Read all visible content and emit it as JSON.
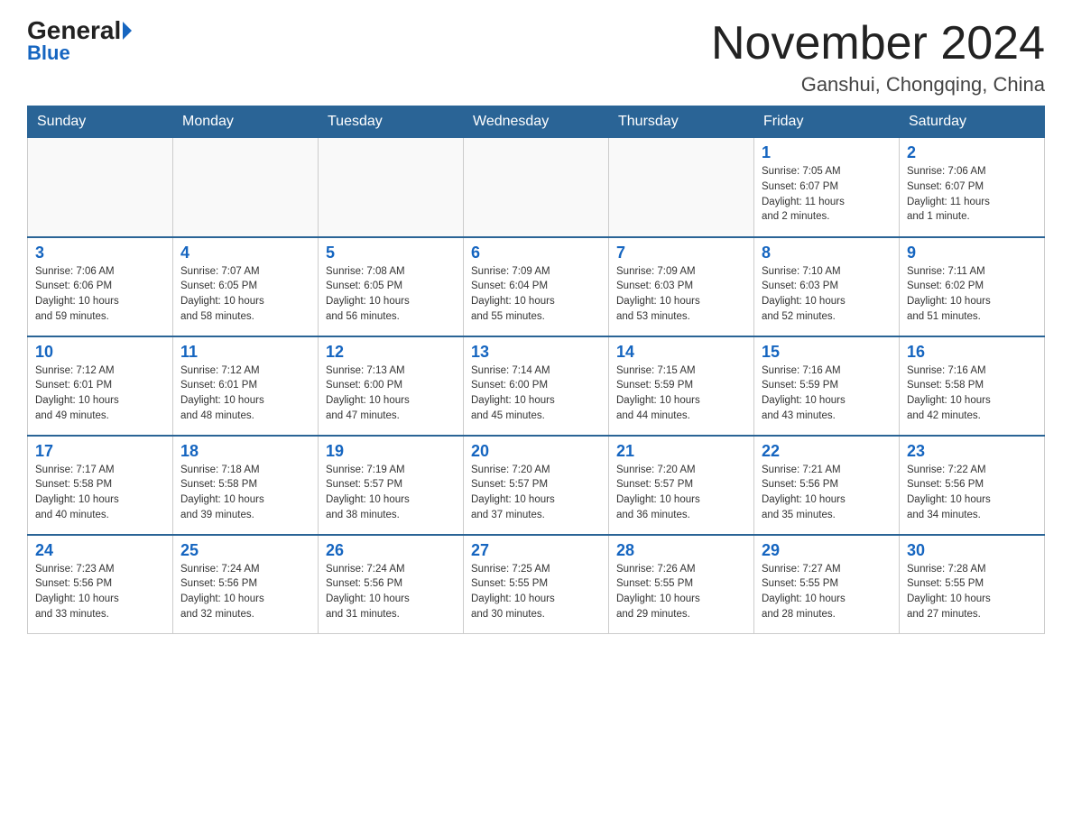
{
  "header": {
    "logo_general": "General",
    "logo_blue": "Blue",
    "title": "November 2024",
    "location": "Ganshui, Chongqing, China"
  },
  "weekdays": [
    "Sunday",
    "Monday",
    "Tuesday",
    "Wednesday",
    "Thursday",
    "Friday",
    "Saturday"
  ],
  "weeks": [
    [
      {
        "day": "",
        "info": ""
      },
      {
        "day": "",
        "info": ""
      },
      {
        "day": "",
        "info": ""
      },
      {
        "day": "",
        "info": ""
      },
      {
        "day": "",
        "info": ""
      },
      {
        "day": "1",
        "info": "Sunrise: 7:05 AM\nSunset: 6:07 PM\nDaylight: 11 hours\nand 2 minutes."
      },
      {
        "day": "2",
        "info": "Sunrise: 7:06 AM\nSunset: 6:07 PM\nDaylight: 11 hours\nand 1 minute."
      }
    ],
    [
      {
        "day": "3",
        "info": "Sunrise: 7:06 AM\nSunset: 6:06 PM\nDaylight: 10 hours\nand 59 minutes."
      },
      {
        "day": "4",
        "info": "Sunrise: 7:07 AM\nSunset: 6:05 PM\nDaylight: 10 hours\nand 58 minutes."
      },
      {
        "day": "5",
        "info": "Sunrise: 7:08 AM\nSunset: 6:05 PM\nDaylight: 10 hours\nand 56 minutes."
      },
      {
        "day": "6",
        "info": "Sunrise: 7:09 AM\nSunset: 6:04 PM\nDaylight: 10 hours\nand 55 minutes."
      },
      {
        "day": "7",
        "info": "Sunrise: 7:09 AM\nSunset: 6:03 PM\nDaylight: 10 hours\nand 53 minutes."
      },
      {
        "day": "8",
        "info": "Sunrise: 7:10 AM\nSunset: 6:03 PM\nDaylight: 10 hours\nand 52 minutes."
      },
      {
        "day": "9",
        "info": "Sunrise: 7:11 AM\nSunset: 6:02 PM\nDaylight: 10 hours\nand 51 minutes."
      }
    ],
    [
      {
        "day": "10",
        "info": "Sunrise: 7:12 AM\nSunset: 6:01 PM\nDaylight: 10 hours\nand 49 minutes."
      },
      {
        "day": "11",
        "info": "Sunrise: 7:12 AM\nSunset: 6:01 PM\nDaylight: 10 hours\nand 48 minutes."
      },
      {
        "day": "12",
        "info": "Sunrise: 7:13 AM\nSunset: 6:00 PM\nDaylight: 10 hours\nand 47 minutes."
      },
      {
        "day": "13",
        "info": "Sunrise: 7:14 AM\nSunset: 6:00 PM\nDaylight: 10 hours\nand 45 minutes."
      },
      {
        "day": "14",
        "info": "Sunrise: 7:15 AM\nSunset: 5:59 PM\nDaylight: 10 hours\nand 44 minutes."
      },
      {
        "day": "15",
        "info": "Sunrise: 7:16 AM\nSunset: 5:59 PM\nDaylight: 10 hours\nand 43 minutes."
      },
      {
        "day": "16",
        "info": "Sunrise: 7:16 AM\nSunset: 5:58 PM\nDaylight: 10 hours\nand 42 minutes."
      }
    ],
    [
      {
        "day": "17",
        "info": "Sunrise: 7:17 AM\nSunset: 5:58 PM\nDaylight: 10 hours\nand 40 minutes."
      },
      {
        "day": "18",
        "info": "Sunrise: 7:18 AM\nSunset: 5:58 PM\nDaylight: 10 hours\nand 39 minutes."
      },
      {
        "day": "19",
        "info": "Sunrise: 7:19 AM\nSunset: 5:57 PM\nDaylight: 10 hours\nand 38 minutes."
      },
      {
        "day": "20",
        "info": "Sunrise: 7:20 AM\nSunset: 5:57 PM\nDaylight: 10 hours\nand 37 minutes."
      },
      {
        "day": "21",
        "info": "Sunrise: 7:20 AM\nSunset: 5:57 PM\nDaylight: 10 hours\nand 36 minutes."
      },
      {
        "day": "22",
        "info": "Sunrise: 7:21 AM\nSunset: 5:56 PM\nDaylight: 10 hours\nand 35 minutes."
      },
      {
        "day": "23",
        "info": "Sunrise: 7:22 AM\nSunset: 5:56 PM\nDaylight: 10 hours\nand 34 minutes."
      }
    ],
    [
      {
        "day": "24",
        "info": "Sunrise: 7:23 AM\nSunset: 5:56 PM\nDaylight: 10 hours\nand 33 minutes."
      },
      {
        "day": "25",
        "info": "Sunrise: 7:24 AM\nSunset: 5:56 PM\nDaylight: 10 hours\nand 32 minutes."
      },
      {
        "day": "26",
        "info": "Sunrise: 7:24 AM\nSunset: 5:56 PM\nDaylight: 10 hours\nand 31 minutes."
      },
      {
        "day": "27",
        "info": "Sunrise: 7:25 AM\nSunset: 5:55 PM\nDaylight: 10 hours\nand 30 minutes."
      },
      {
        "day": "28",
        "info": "Sunrise: 7:26 AM\nSunset: 5:55 PM\nDaylight: 10 hours\nand 29 minutes."
      },
      {
        "day": "29",
        "info": "Sunrise: 7:27 AM\nSunset: 5:55 PM\nDaylight: 10 hours\nand 28 minutes."
      },
      {
        "day": "30",
        "info": "Sunrise: 7:28 AM\nSunset: 5:55 PM\nDaylight: 10 hours\nand 27 minutes."
      }
    ]
  ]
}
